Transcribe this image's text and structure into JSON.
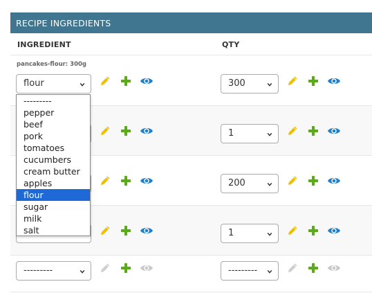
{
  "section": {
    "title": "RECIPE INGREDIENTS"
  },
  "columns": {
    "ingredient": "INGREDIENT",
    "qty": "QTY"
  },
  "rows": [
    {
      "original": "pancakes-flour: 300g",
      "ingredient": "flour",
      "qty": "300"
    },
    {
      "ingredient": "",
      "qty": "1"
    },
    {
      "ingredient": "",
      "qty": "200"
    },
    {
      "ingredient": "",
      "qty": "1"
    },
    {
      "ingredient": "---------",
      "qty": "---------"
    }
  ],
  "dropdown": {
    "options": [
      "---------",
      "pepper",
      "beef",
      "pork",
      "tomatoes",
      "cucumbers",
      "cream butter",
      "apples",
      "flour",
      "sugar",
      "milk",
      "salt"
    ],
    "selected": "flour"
  },
  "colors": {
    "header_bg": "#417690",
    "edit_icon": "#f0c000",
    "add_icon": "#5aaa1a",
    "view_icon": "#1f80c8",
    "disabled_icon": "#c8c8c8",
    "dropdown_highlight": "#1e69d6"
  }
}
